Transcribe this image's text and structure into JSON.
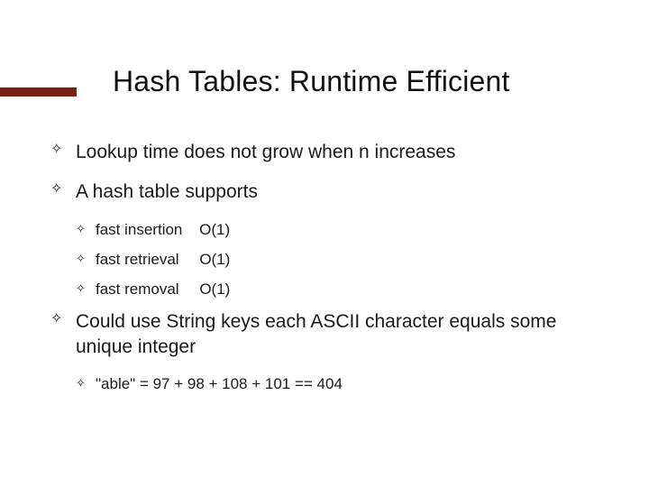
{
  "title": "Hash Tables: Runtime Efficient",
  "bullets": {
    "b1": "Lookup time does not grow when n increases",
    "b2": "A hash table supports",
    "b2_subs": {
      "s1_label": "fast insertion",
      "s1_o": "O(1)",
      "s2_label": "fast retrieval",
      "s2_o": "O(1)",
      "s3_label": "fast removal",
      "s3_o": "O(1)"
    },
    "b3": "Could use String keys each ASCII character equals some unique integer",
    "b3_subs": {
      "s1": "\"able\" = 97 + 98 + 108 + 101 == 404"
    }
  },
  "accent_color": "#7a1f14"
}
